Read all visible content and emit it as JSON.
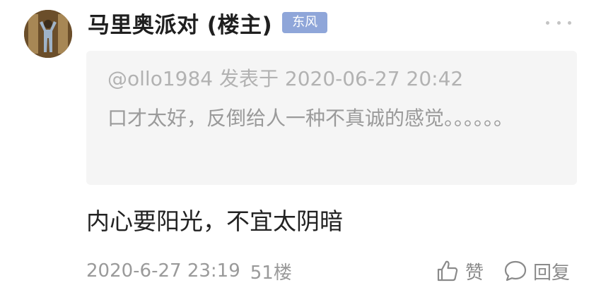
{
  "post": {
    "author": "马里奥派对 (楼主)",
    "badge": "东风",
    "quote": {
      "meta": "@ollo1984 发表于 2020-06-27 20:42",
      "text": "口才太好，反倒给人一种不真诚的感觉。。。。。。"
    },
    "content": "内心要阳光，不宜太阴暗",
    "time": "2020-6-27 23:19",
    "floor": "51楼",
    "actions": {
      "like_label": "赞",
      "reply_label": "回复"
    }
  },
  "icons": {
    "more": "more-dots-icon",
    "like": "thumbs-up-icon",
    "reply": "comment-bubble-icon"
  },
  "colors": {
    "badge_bg": "#8fa6d9",
    "quote_bg": "#f5f5f5",
    "muted_text": "#9a9a9a"
  }
}
